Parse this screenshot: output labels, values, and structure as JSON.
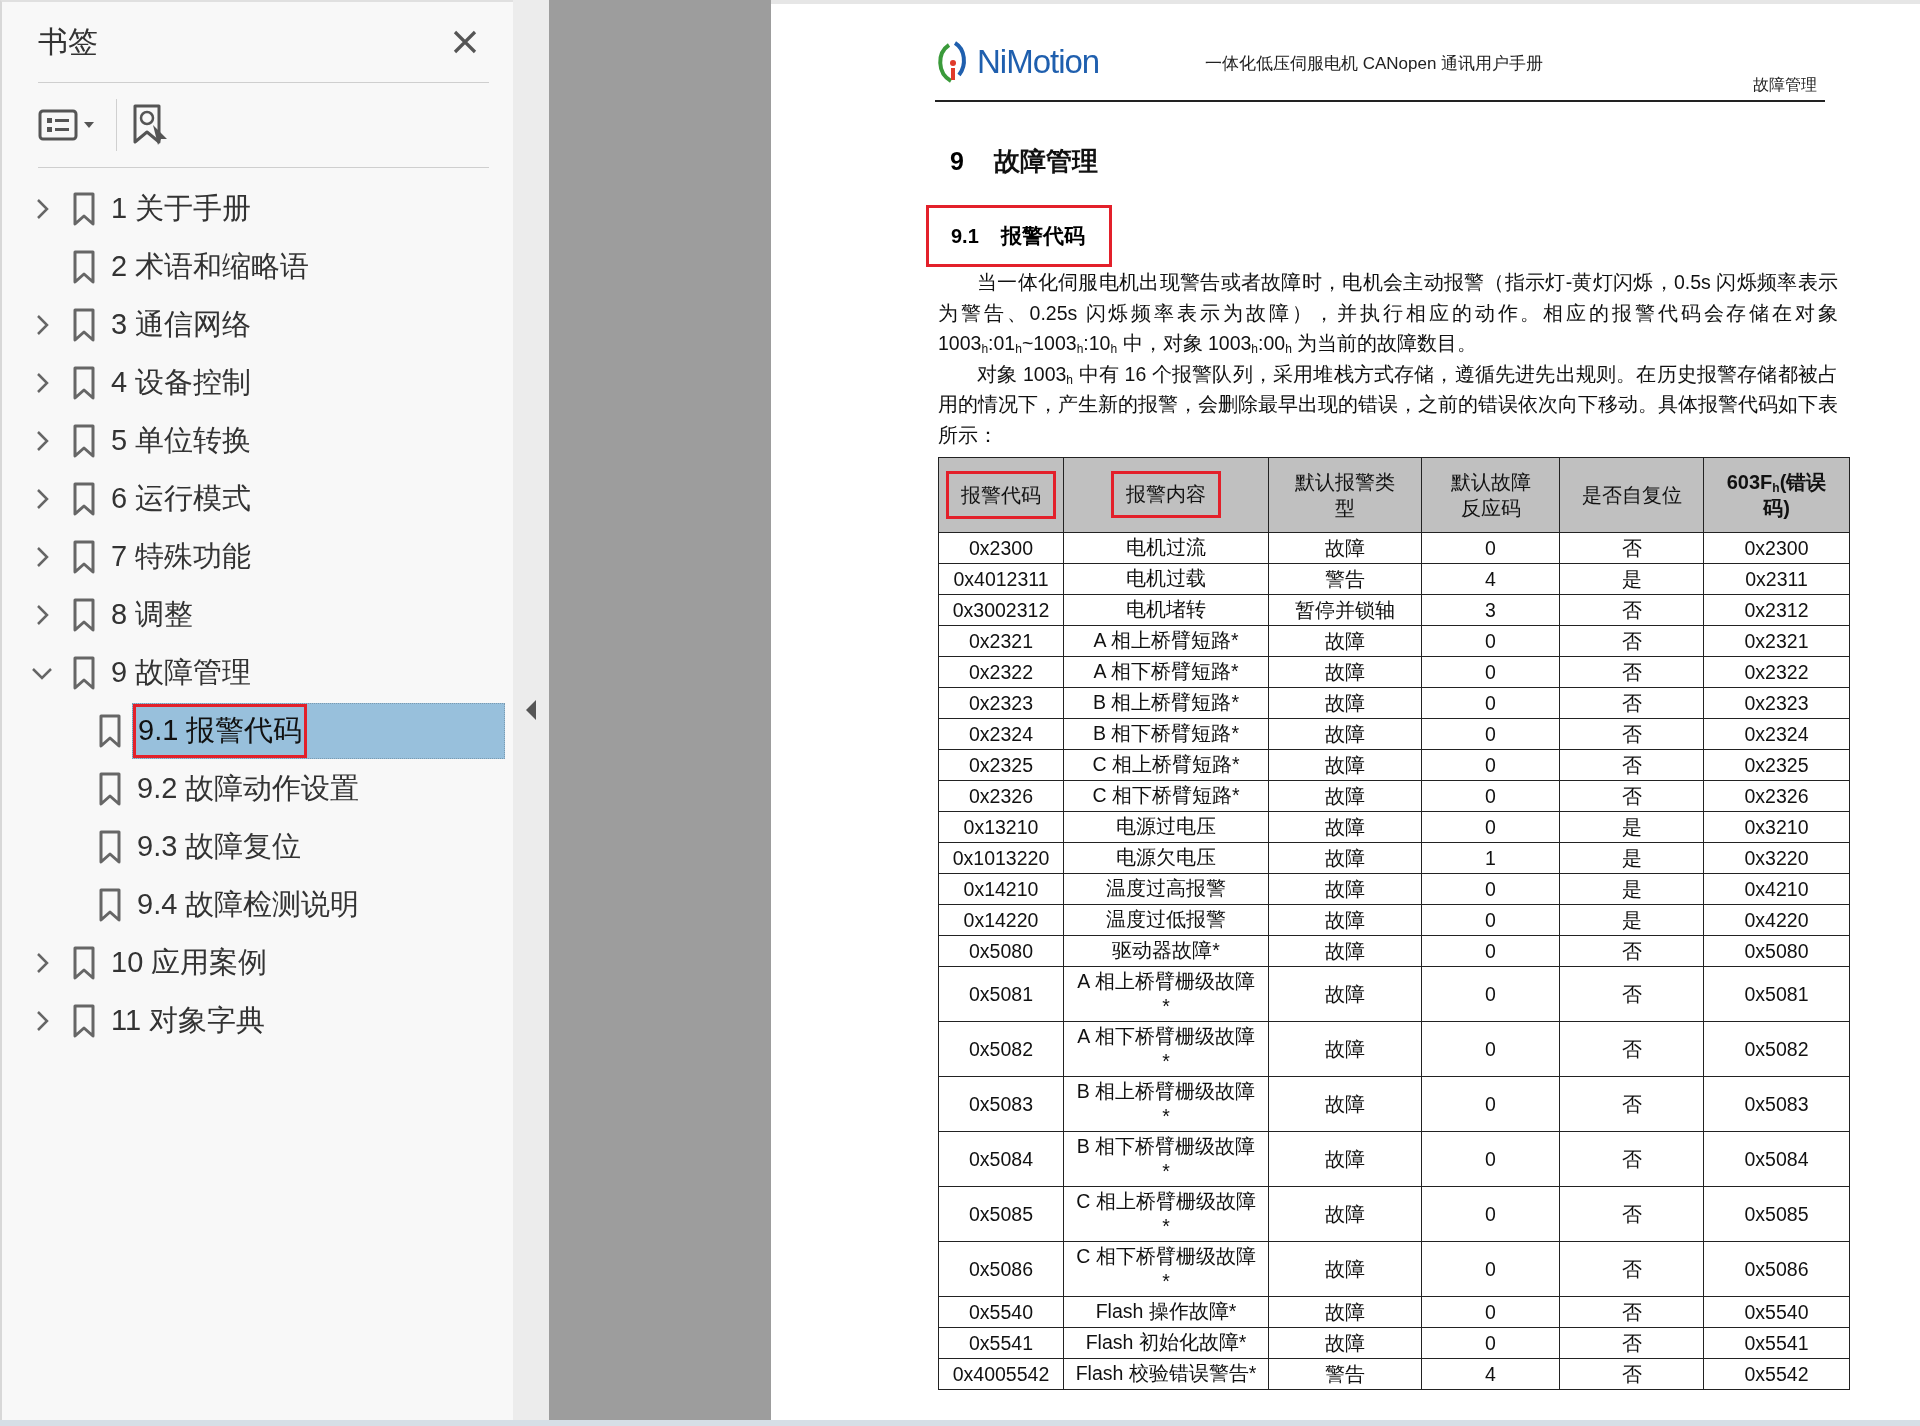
{
  "sidebar": {
    "title": "书签",
    "bookmarks": [
      {
        "label": "1 关于手册",
        "kind": "folder",
        "expanded": false,
        "selected": false,
        "marked": false
      },
      {
        "label": "2 术语和缩略语",
        "kind": "leaf",
        "selected": false,
        "marked": false
      },
      {
        "label": "3 通信网络",
        "kind": "folder",
        "expanded": false,
        "selected": false,
        "marked": false
      },
      {
        "label": "4 设备控制",
        "kind": "folder",
        "expanded": false,
        "selected": false,
        "marked": false
      },
      {
        "label": "5 单位转换",
        "kind": "folder",
        "expanded": false,
        "selected": false,
        "marked": false
      },
      {
        "label": "6 运行模式",
        "kind": "folder",
        "expanded": false,
        "selected": false,
        "marked": false
      },
      {
        "label": "7 特殊功能",
        "kind": "folder",
        "expanded": false,
        "selected": false,
        "marked": false
      },
      {
        "label": "8 调整",
        "kind": "folder",
        "expanded": false,
        "selected": false,
        "marked": false
      },
      {
        "label": "9 故障管理",
        "kind": "folder",
        "expanded": true,
        "selected": false,
        "marked": false,
        "children": [
          {
            "label": "9.1 报警代码",
            "kind": "leaf",
            "selected": true,
            "marked": true
          },
          {
            "label": "9.2 故障动作设置",
            "kind": "leaf",
            "selected": false,
            "marked": false
          },
          {
            "label": "9.3 故障复位",
            "kind": "leaf",
            "selected": false,
            "marked": false
          },
          {
            "label": "9.4 故障检测说明",
            "kind": "leaf",
            "selected": false,
            "marked": false
          }
        ]
      },
      {
        "label": "10 应用案例",
        "kind": "folder",
        "expanded": false,
        "selected": false,
        "marked": false
      },
      {
        "label": "11 对象字典",
        "kind": "folder",
        "expanded": false,
        "selected": false,
        "marked": false
      }
    ]
  },
  "document": {
    "logo": "NiMotion",
    "running_title": "一体化低压伺服电机 CANopen 通讯用户手册",
    "chapter_tag": "故障管理",
    "chapter": {
      "number": "9",
      "title": "故障管理"
    },
    "section": {
      "number": "9.1",
      "title": "报警代码",
      "marked": true
    },
    "paragraphs": [
      "当一体化伺服电机出现警告或者故障时，电机会主动报警（指示灯-黄灯闪烁，0.5s 闪烁频率表示为警告、0.25s 闪烁频率表示为故障），并执行相应的动作。相应的报警代码会存储在对象 1003$_{h}$:01$_{h}$~1003$_{h}$:10$_{h}$ 中，对象 1003$_{h}$:00$_{h}$ 为当前的故障数目。",
      "对象 1003$_{h}$ 中有 16 个报警队列，采用堆栈方式存储，遵循先进先出规则。在历史报警存储都被占用的情况下，产生新的报警，会删除最早出现的错误，之前的错误依次向下移动。具体报警代码如下表所示："
    ],
    "table": {
      "columns": [
        {
          "label": "报警代码",
          "marked": true
        },
        {
          "label": "报警内容",
          "marked": true
        },
        {
          "label": "默认报警类型",
          "marked": false
        },
        {
          "label": "默认故障反应码",
          "marked": false
        },
        {
          "label": "是否自复位",
          "marked": false
        },
        {
          "label": "603F$_{h}$(错误码)",
          "marked": false
        }
      ],
      "rows": [
        [
          "0x2300",
          "电机过流",
          "故障",
          "0",
          "否",
          "0x2300"
        ],
        [
          "0x4012311",
          "电机过载",
          "警告",
          "4",
          "是",
          "0x2311"
        ],
        [
          "0x3002312",
          "电机堵转",
          "暂停并锁轴",
          "3",
          "否",
          "0x2312"
        ],
        [
          "0x2321",
          "A 相上桥臂短路*",
          "故障",
          "0",
          "否",
          "0x2321"
        ],
        [
          "0x2322",
          "A 相下桥臂短路*",
          "故障",
          "0",
          "否",
          "0x2322"
        ],
        [
          "0x2323",
          "B 相上桥臂短路*",
          "故障",
          "0",
          "否",
          "0x2323"
        ],
        [
          "0x2324",
          "B 相下桥臂短路*",
          "故障",
          "0",
          "否",
          "0x2324"
        ],
        [
          "0x2325",
          "C 相上桥臂短路*",
          "故障",
          "0",
          "否",
          "0x2325"
        ],
        [
          "0x2326",
          "C 相下桥臂短路*",
          "故障",
          "0",
          "否",
          "0x2326"
        ],
        [
          "0x13210",
          "电源过电压",
          "故障",
          "0",
          "是",
          "0x3210"
        ],
        [
          "0x1013220",
          "电源欠电压",
          "故障",
          "1",
          "是",
          "0x3220"
        ],
        [
          "0x14210",
          "温度过高报警",
          "故障",
          "0",
          "是",
          "0x4210"
        ],
        [
          "0x14220",
          "温度过低报警",
          "故障",
          "0",
          "是",
          "0x4220"
        ],
        [
          "0x5080",
          "驱动器故障*",
          "故障",
          "0",
          "否",
          "0x5080"
        ],
        [
          "0x5081",
          "A 相上桥臂栅级故障*",
          "故障",
          "0",
          "否",
          "0x5081"
        ],
        [
          "0x5082",
          "A 相下桥臂栅级故障*",
          "故障",
          "0",
          "否",
          "0x5082"
        ],
        [
          "0x5083",
          "B 相上桥臂栅级故障*",
          "故障",
          "0",
          "否",
          "0x5083"
        ],
        [
          "0x5084",
          "B 相下桥臂栅级故障*",
          "故障",
          "0",
          "否",
          "0x5084"
        ],
        [
          "0x5085",
          "C 相上桥臂栅级故障*",
          "故障",
          "0",
          "否",
          "0x5085"
        ],
        [
          "0x5086",
          "C 相下桥臂栅级故障*",
          "故障",
          "0",
          "否",
          "0x5086"
        ],
        [
          "0x5540",
          "Flash 操作故障*",
          "故障",
          "0",
          "否",
          "0x5540"
        ],
        [
          "0x5541",
          "Flash 初始化故障*",
          "故障",
          "0",
          "否",
          "0x5541"
        ],
        [
          "0x4005542",
          "Flash 校验错误警告*",
          "警告",
          "4",
          "否",
          "0x5542"
        ]
      ]
    }
  }
}
